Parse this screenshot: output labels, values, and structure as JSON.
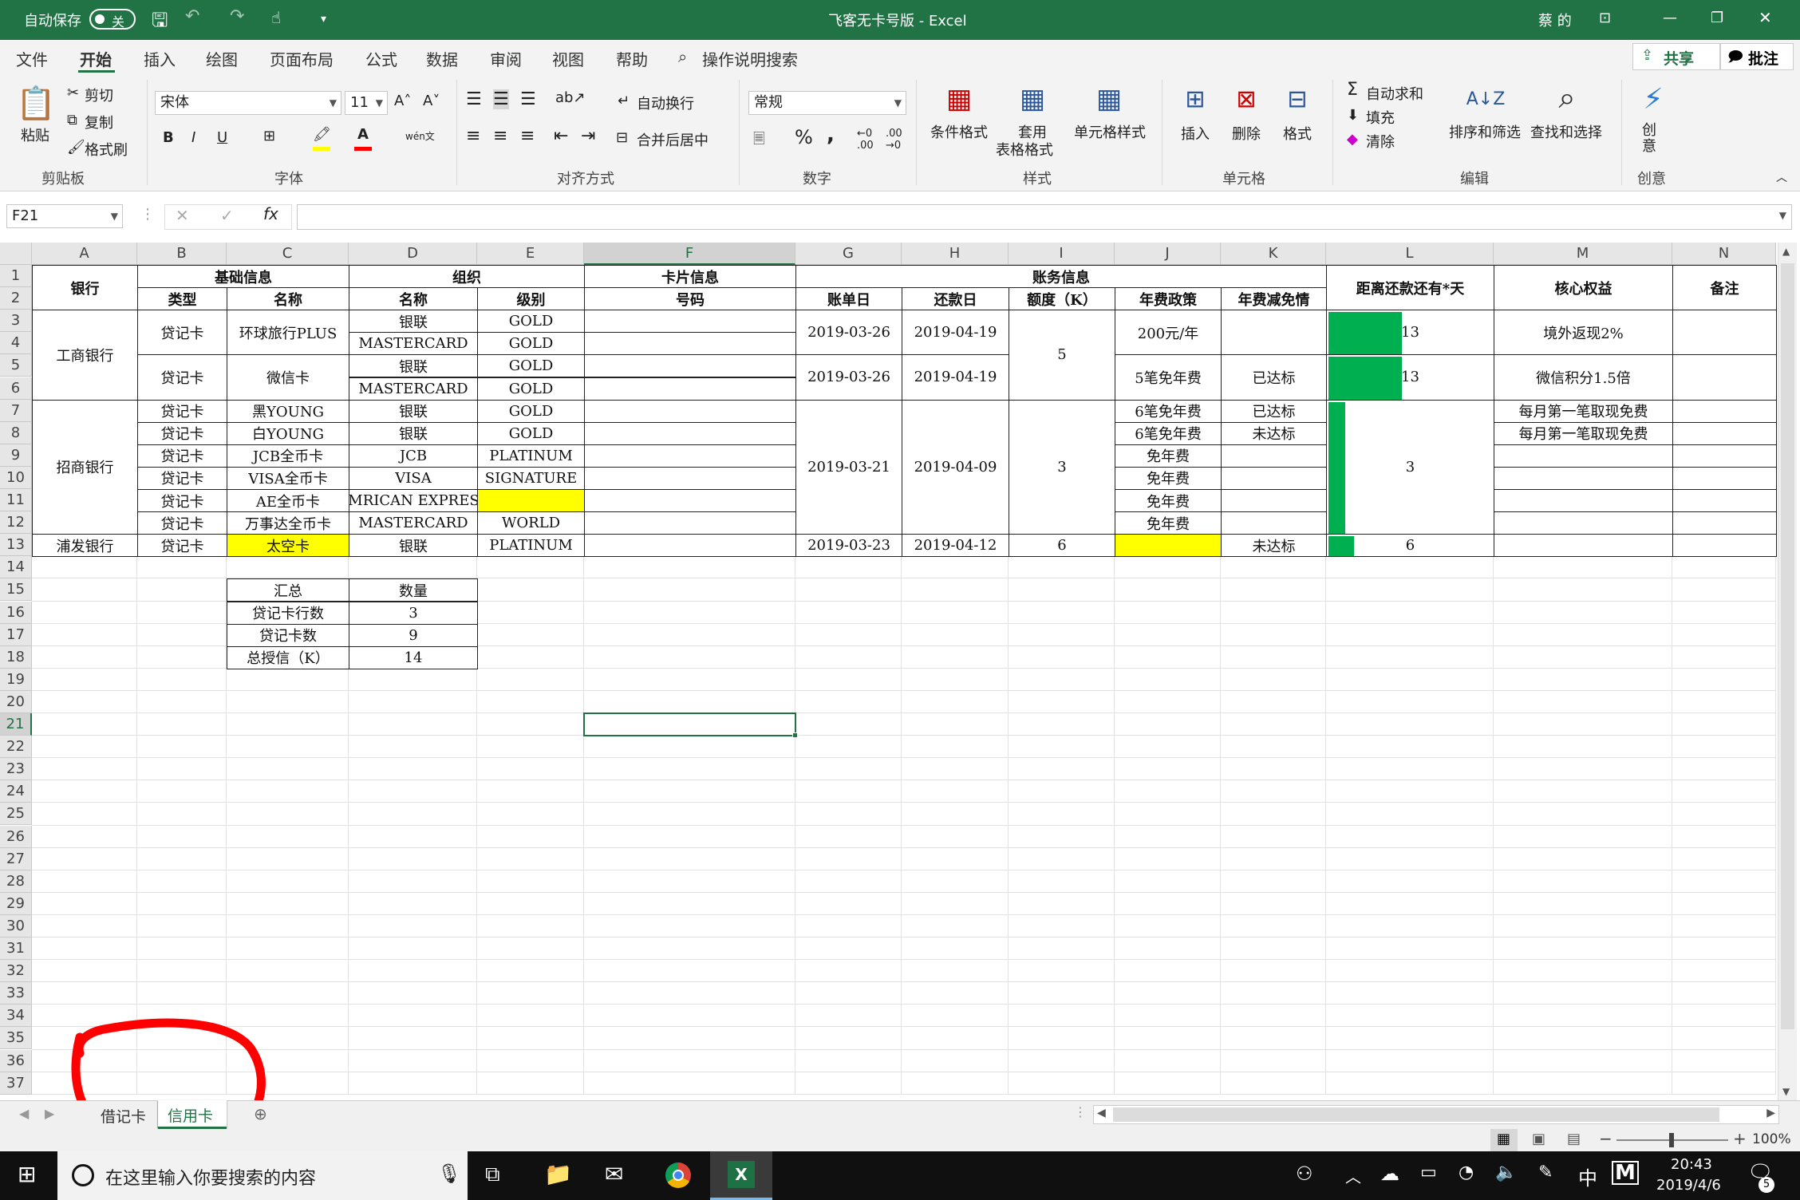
{
  "title": {
    "autosave_label": "自动保存",
    "autosave_state": "关",
    "document": "飞客无卡号版  -  Excel",
    "user": "蔡 的"
  },
  "menu": {
    "tabs": [
      "文件",
      "开始",
      "插入",
      "绘图",
      "页面布局",
      "公式",
      "数据",
      "审阅",
      "视图",
      "帮助"
    ],
    "search": "操作说明搜索",
    "share": "共享",
    "comment": "批注"
  },
  "ribbon": {
    "paste": "粘贴",
    "cut": "剪切",
    "copy": "复制",
    "format_painter": "格式刷",
    "font_name": "宋体",
    "font_size": "11",
    "wrap": "自动换行",
    "merge": "合并后居中",
    "number_format": "常规",
    "cond_format": "条件格式",
    "table_format_1": "套用",
    "table_format_2": "表格格式",
    "cell_styles": "单元格样式",
    "insert": "插入",
    "delete": "删除",
    "format": "格式",
    "autosum": "自动求和",
    "fill": "填充",
    "clear": "清除",
    "sort_filter": "排序和筛选",
    "find_select": "查找和选择",
    "create": "创意",
    "groups": [
      "剪贴板",
      "字体",
      "对齐方式",
      "数字",
      "样式",
      "单元格",
      "编辑",
      "创意"
    ]
  },
  "formula_bar": {
    "name_box": "F21",
    "formula": ""
  },
  "columns": [
    "A",
    "B",
    "C",
    "D",
    "E",
    "F",
    "G",
    "H",
    "I",
    "J",
    "K",
    "L",
    "M",
    "N"
  ],
  "rows": [
    "1",
    "2",
    "3",
    "4",
    "5",
    "6",
    "7",
    "8",
    "9",
    "10",
    "11",
    "12",
    "13",
    "14",
    "15",
    "16",
    "17",
    "18",
    "19",
    "20",
    "21",
    "22",
    "23",
    "24",
    "25",
    "26",
    "27",
    "28",
    "29",
    "30",
    "31",
    "32",
    "33",
    "34",
    "35",
    "36",
    "37"
  ],
  "headers": {
    "bank": "银行",
    "basic": "基础信息",
    "org": "组织",
    "cardinfo": "卡片信息",
    "account": "账务信息",
    "days_left": "距离还款还有*天",
    "core_benefit": "核心权益",
    "remarks": "备注",
    "type": "类型",
    "name": "名称",
    "org_name": "名称",
    "level": "级别",
    "number": "号码",
    "bill_day": "账单日",
    "repay_day": "还款日",
    "limit": "额度（K）",
    "fee_policy": "年费政策",
    "fee_waive": "年费减免情"
  },
  "banks": [
    {
      "name": "工商银行",
      "limit": "5",
      "groups": [
        {
          "type": "贷记卡",
          "name": "环球旅行PLUS",
          "bill": "2019-03-26",
          "repay": "2019-04-19",
          "fee": "200元/年",
          "waive": "",
          "days": "13",
          "days_fill": 0.44,
          "benefit": "境外返现2%",
          "orgs": [
            {
              "org": "银联",
              "level": "GOLD"
            },
            {
              "org": "MASTERCARD",
              "level": "GOLD"
            }
          ]
        },
        {
          "type": "贷记卡",
          "name": "微信卡",
          "bill": "2019-03-26",
          "repay": "2019-04-19",
          "fee": "5笔免年费",
          "waive": "已达标",
          "days": "13",
          "days_fill": 0.44,
          "benefit": "微信积分1.5倍",
          "orgs": [
            {
              "org": "银联",
              "level": "GOLD"
            },
            {
              "org": "MASTERCARD",
              "level": "GOLD"
            }
          ]
        }
      ]
    },
    {
      "name": "招商银行",
      "bill": "2019-03-21",
      "repay": "2019-04-09",
      "limit": "3",
      "days": "3",
      "days_fill": 0.1,
      "cards": [
        {
          "type": "贷记卡",
          "name": "黑YOUNG",
          "org": "银联",
          "level": "GOLD",
          "fee": "6笔免年费",
          "waive": "已达标",
          "benefit": "每月第一笔取现免费"
        },
        {
          "type": "贷记卡",
          "name": "白YOUNG",
          "org": "银联",
          "level": "GOLD",
          "fee": "6笔免年费",
          "waive": "未达标",
          "benefit": "每月第一笔取现免费"
        },
        {
          "type": "贷记卡",
          "name": "JCB全币卡",
          "org": "JCB",
          "level": "PLATINUM",
          "fee": "免年费",
          "waive": "",
          "benefit": ""
        },
        {
          "type": "贷记卡",
          "name": "VISA全币卡",
          "org": "VISA",
          "level": "SIGNATURE",
          "fee": "免年费",
          "waive": "",
          "benefit": ""
        },
        {
          "type": "贷记卡",
          "name": "AE全币卡",
          "org": "AMRICAN EXPRESS",
          "level": "",
          "fee": "免年费",
          "waive": "",
          "benefit": ""
        },
        {
          "type": "贷记卡",
          "name": "万事达全币卡",
          "org": "MASTERCARD",
          "level": "WORLD",
          "fee": "免年费",
          "waive": "",
          "benefit": ""
        }
      ]
    },
    {
      "name": "浦发银行",
      "card": {
        "type": "贷记卡",
        "name": "太空卡",
        "org": "银联",
        "level": "PLATINUM",
        "bill": "2019-03-23",
        "repay": "2019-04-12",
        "limit": "6",
        "fee": "",
        "waive": "未达标",
        "days": "6",
        "days_fill": 0.15,
        "benefit": ""
      }
    }
  ],
  "summary": {
    "header": [
      "汇总",
      "数量"
    ],
    "rows": [
      [
        "贷记卡行数",
        "3"
      ],
      [
        "贷记卡数",
        "9"
      ],
      [
        "总授信（K）",
        "14"
      ]
    ]
  },
  "sheet_tabs": [
    "借记卡",
    "信用卡"
  ],
  "active_sheet": "信用卡",
  "zoom": "100%",
  "taskbar": {
    "search": "在这里输入你要搜索的内容",
    "time": "20:43",
    "date": "2019/4/6",
    "ime": "中",
    "notifications": "5"
  },
  "colors": {
    "excel_green": "#217346",
    "highlight_yellow": "#ffff00",
    "databar_green": "#00b050",
    "annotation_red": "#ff0000"
  }
}
